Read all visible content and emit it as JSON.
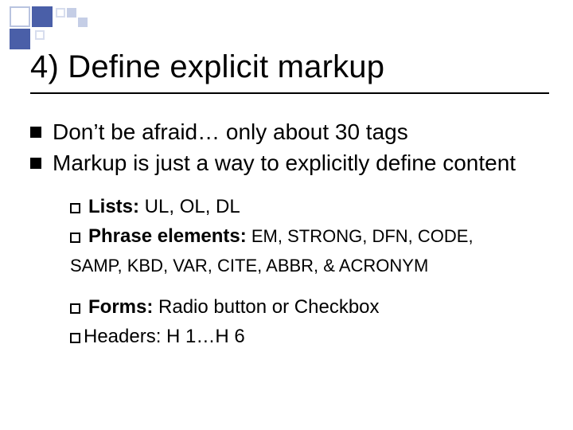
{
  "title": "4) Define explicit markup",
  "bullets": {
    "b1": "Don’t be afraid… only about 30 tags",
    "b2": "Markup is just a way to explicitly define content"
  },
  "sub": {
    "lists_label": "Lists:",
    "lists_text": " UL, OL, DL",
    "phrase_label": "Phrase elements:",
    "phrase_text_1": " EM, STRONG, DFN, CODE,",
    "phrase_text_2": "SAMP, KBD, VAR, CITE, ABBR, & ACRONYM",
    "forms_label": "Forms:",
    "forms_text": " Radio button or Checkbox",
    "headers_label": "Headers:",
    "headers_text": " H 1…H 6"
  }
}
